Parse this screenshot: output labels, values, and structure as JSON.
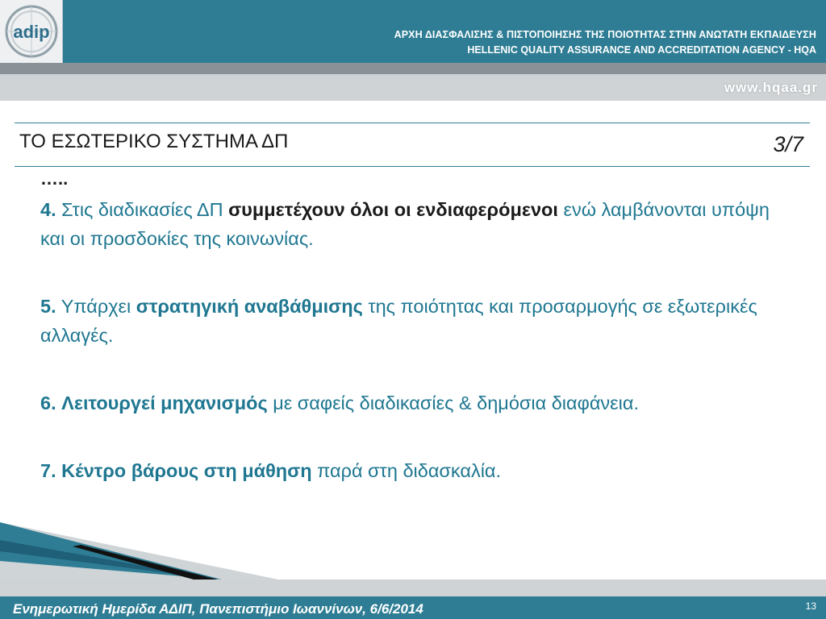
{
  "header": {
    "logo_text": "adip",
    "org_name_greek": "ΑΡΧΗ ΔΙΑΣΦΑΛΙΣΗΣ & ΠΙΣΤΟΠΟΙΗΣΗΣ ΤΗΣ ΠΟΙΟΤΗΤΑΣ ΣΤΗΝ ΑΝΩΤΑΤΗ ΕΚΠΑΙΔΕΥΣΗ",
    "org_name_english": "HELLENIC QUALITY ASSURANCE AND ACCREDITATION AGENCY - HQA",
    "website": "www.hqaa.gr"
  },
  "slide": {
    "title": "ΤΟ ΕΣΩΤΕΡΙΚΟ ΣΥΣΤΗΜΑ ΔΠ",
    "page_indicator": "3/7",
    "ellipsis": "…..",
    "items": [
      {
        "num": "4.",
        "pre": " Στις διαδικασίες ΔΠ ",
        "bold": "συμμετέχουν όλοι οι ενδιαφερόμενοι",
        "post": " ενώ λαμβάνονται υπόψη και οι προσδοκίες της κοινωνίας."
      },
      {
        "num": "5.",
        "pre": " Υπάρχει ",
        "bold": "στρατηγική αναβάθμισης",
        "post": " της ποιότητας και προσαρμογής σε εξωτερικές αλλαγές."
      },
      {
        "num": "6.",
        "pre": " ",
        "bold": "Λειτουργεί μηχανισμός",
        "post": " με σαφείς διαδικασίες & δημόσια διαφάνεια."
      },
      {
        "num": "7.",
        "pre": " ",
        "bold": "Κέντρο βάρους στη μάθηση",
        "post": " παρά στη διδασκαλία."
      }
    ]
  },
  "footer": {
    "event": "Ενημερωτική Ημερίδα ΑΔΙΠ, Πανεπιστήμιο Ιωαννίνων, 6/6/2014",
    "page_number": "13"
  },
  "colors": {
    "header_teal": "#2e7d94",
    "text_teal": "#1f7791",
    "gray_band": "#8a9197",
    "light_gray_band": "#d0d3d5"
  }
}
